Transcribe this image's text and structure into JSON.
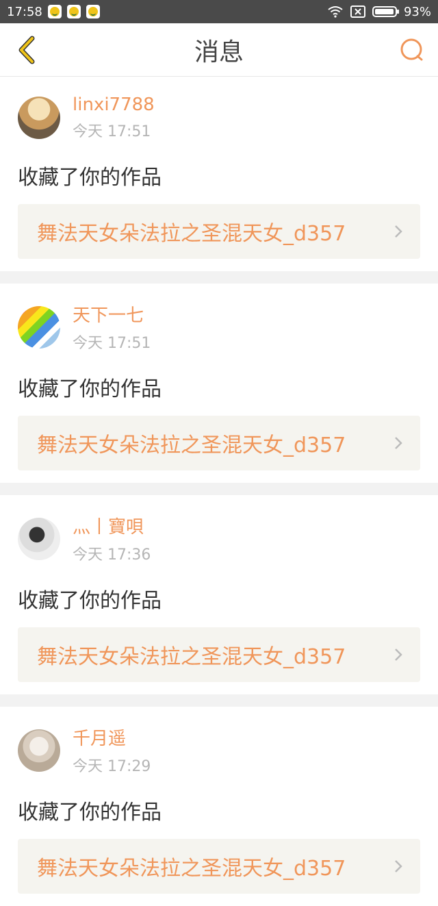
{
  "status_bar": {
    "time": "17:58",
    "battery_percent": "93%",
    "icons": [
      "notification-app-icon",
      "notification-app-icon",
      "notification-app-icon",
      "wifi-icon",
      "no-sim-icon",
      "battery-icon"
    ]
  },
  "header": {
    "title": "消息",
    "back_icon": "chevron-left-icon",
    "search_icon": "search-icon"
  },
  "colors": {
    "accent": "#f0965a",
    "back_arrow": "#f0c419",
    "status_bar": "#4a4a4a"
  },
  "messages": [
    {
      "username": "linxi7788",
      "time": "今天 17:51",
      "action": "收藏了你的作品",
      "work_title": "舞法天女朵法拉之圣混天女_d357"
    },
    {
      "username": "天下一七",
      "time": "今天 17:51",
      "action": "收藏了你的作品",
      "work_title": "舞法天女朵法拉之圣混天女_d357"
    },
    {
      "username": "灬丨寶唄",
      "time": "今天 17:36",
      "action": "收藏了你的作品",
      "work_title": "舞法天女朵法拉之圣混天女_d357"
    },
    {
      "username": "千月遥",
      "time": "今天 17:29",
      "action": "收藏了你的作品",
      "work_title": "舞法天女朵法拉之圣混天女_d357"
    }
  ]
}
